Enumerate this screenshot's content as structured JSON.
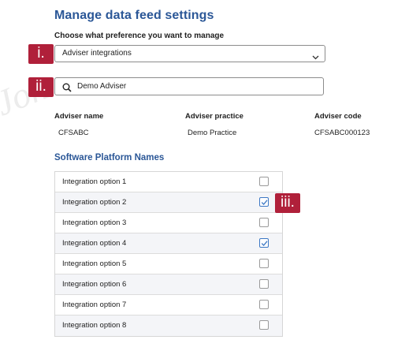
{
  "watermark": "Jon",
  "page_title": "Manage data feed settings",
  "preference": {
    "label": "Choose what preference you want to manage",
    "selected": "Adviser integrations"
  },
  "search": {
    "value": "Demo Adviser"
  },
  "markers": [
    "i.",
    "ii.",
    "iii."
  ],
  "adviser": {
    "headers": [
      "Adviser name",
      "Adviser practice",
      "Adviser code"
    ],
    "values": [
      "CFSABC",
      "Demo Practice",
      "CFSABC000123"
    ]
  },
  "platforms": {
    "title": "Software Platform Names",
    "items": [
      {
        "label": "Integration option 1",
        "checked": false
      },
      {
        "label": "Integration option 2",
        "checked": true
      },
      {
        "label": "Integration option 3",
        "checked": false
      },
      {
        "label": "Integration option 4",
        "checked": true
      },
      {
        "label": "Integration option 5",
        "checked": false
      },
      {
        "label": "Integration  option 6",
        "checked": false
      },
      {
        "label": "Integration  option 7",
        "checked": false
      },
      {
        "label": "Integration option 8",
        "checked": false
      }
    ]
  },
  "colors": {
    "title": "#2b5797",
    "marker": "#b0203a",
    "check": "#3d78c4",
    "alt_row": "#f4f5f8"
  },
  "icons": {
    "dropdown": "chevron-down-icon",
    "search": "search-icon",
    "checkbox": "checkmark-icon"
  }
}
